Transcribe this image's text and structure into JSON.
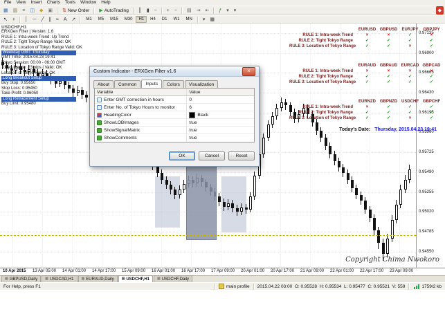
{
  "menu": {
    "items": [
      "File",
      "View",
      "Insert",
      "Charts",
      "Tools",
      "Window",
      "Help"
    ]
  },
  "toolbar1": {
    "items": [
      {
        "name": "new-chart-icon",
        "glyph": "▦",
        "color": "#3c6eb4"
      },
      {
        "name": "profiles-icon",
        "glyph": "▥",
        "color": "#8a7a52"
      },
      {
        "name": "market-watch-icon",
        "glyph": "≡",
        "color": "#2e8b57"
      },
      {
        "name": "data-window-icon",
        "glyph": "◫",
        "color": "#3c6eb4"
      },
      {
        "name": "navigator-icon",
        "glyph": "◆",
        "color": "#c8a028"
      },
      {
        "name": "terminal-icon",
        "glyph": "▣",
        "color": "#777777"
      },
      {
        "sep": true
      },
      {
        "name": "new-order-button",
        "label": "New Order",
        "glyph": "⇅",
        "color": "#c03020"
      },
      {
        "sep": true
      },
      {
        "name": "autotrading-button",
        "label": "AutoTrading",
        "glyph": "▶",
        "color": "#2e9e3a"
      },
      {
        "sep": true
      },
      {
        "name": "bar-chart-icon",
        "glyph": "║",
        "color": "#444444"
      },
      {
        "name": "candlestick-chart-icon",
        "glyph": "▮",
        "color": "#444444"
      },
      {
        "name": "line-chart-icon",
        "glyph": "~",
        "color": "#444444"
      },
      {
        "sep": true
      },
      {
        "name": "zoom-in-icon",
        "glyph": "+",
        "color": "#444444"
      },
      {
        "name": "zoom-out-icon",
        "glyph": "−",
        "color": "#444444"
      },
      {
        "sep": true
      },
      {
        "name": "tile-windows-icon",
        "glyph": "▤",
        "color": "#666666"
      },
      {
        "name": "auto-scroll-icon",
        "glyph": "⇥",
        "color": "#666666"
      },
      {
        "name": "chart-shift-icon",
        "glyph": "⇤",
        "color": "#666666"
      },
      {
        "sep": true
      },
      {
        "name": "indicators-icon",
        "glyph": "ƒ",
        "color": "#2e7d32"
      },
      {
        "name": "indicator-list-dropdown",
        "glyph": "▾",
        "color": "#444444"
      },
      {
        "name": "templates-dropdown",
        "glyph": "▾",
        "color": "#444444"
      },
      {
        "name": "community-icon",
        "glyph": "◆",
        "color": "#ffffff",
        "bg": "#d03a2a",
        "right": true
      }
    ]
  },
  "toolbar2": {
    "active": "H1",
    "items": [
      {
        "name": "cursor-icon",
        "glyph": "↖",
        "color": "#333333"
      },
      {
        "name": "crosshair-icon",
        "glyph": "+",
        "color": "#333333"
      },
      {
        "sep": true
      },
      {
        "name": "vertical-line-icon",
        "glyph": "│",
        "color": "#333333"
      },
      {
        "name": "horizontal-line-icon",
        "glyph": "─",
        "color": "#333333"
      },
      {
        "name": "trendline-icon",
        "glyph": "╱",
        "color": "#333333"
      },
      {
        "name": "channel-icon",
        "glyph": "∥",
        "color": "#333333"
      },
      {
        "name": "fibonacci-icon",
        "glyph": "≈",
        "color": "#333333"
      },
      {
        "name": "text-icon",
        "glyph": "A",
        "color": "#333333"
      },
      {
        "name": "arrow-icon",
        "glyph": "↗",
        "color": "#333333"
      },
      {
        "sep": true
      },
      {
        "tf": "M1"
      },
      {
        "tf": "M5"
      },
      {
        "tf": "M15"
      },
      {
        "tf": "M30"
      },
      {
        "tf": "H1"
      },
      {
        "tf": "H4"
      },
      {
        "tf": "D1"
      },
      {
        "tf": "W1"
      },
      {
        "tf": "MN"
      },
      {
        "sep": true
      },
      {
        "name": "period-dropdown",
        "glyph": "▾",
        "color": "#444444"
      },
      {
        "name": "template-icon",
        "glyph": "▦",
        "color": "#444444"
      }
    ]
  },
  "chart": {
    "comments": [
      {
        "text": "USDCHF,H1",
        "style": "symbol"
      },
      {
        "text": "ERXGen Filter | Version: 1.6"
      },
      {
        "text": "RULE 1: Intra-week Trend: Up Trend"
      },
      {
        "text": "RULE 2: Tight Tokyo Range Valid: OK"
      },
      {
        "text": "RULE 3: Location of Tokyo Range Valid: OK"
      },
      {
        "text": "Weekday GMT: Thursday",
        "highlight": true
      },
      {
        "text": "GMT Time: 2015.04.23 19:41"
      },
      {
        "text": "Tokyo Session: 00:00 - 06:00 GMT"
      },
      {
        "text": "Tokyo Range: 23 pips | Valid: OK"
      },
      {
        "text": "Location of Tokyo Range: OK"
      },
      {
        "text": "Long Breakout Setup",
        "highlight": true
      },
      {
        "text": "Buy Stop: 0.95650"
      },
      {
        "text": "Stop Loss: 0.95450"
      },
      {
        "text": "Take Profit: 0.96050"
      },
      {
        "text": "Long Retracement Setup",
        "highlight": true
      },
      {
        "text": "Buy Limit: 0.95480"
      }
    ]
  },
  "chart_data": {
    "type": "candlestick",
    "symbol": "USDCHF",
    "period": "H1",
    "ylim": [
      0.9435,
      0.9725
    ],
    "price_axis_labels": [
      0.97135,
      0.969,
      0.96665,
      0.9643,
      0.96195,
      0.9596,
      0.95725,
      0.9549,
      0.95255,
      0.9502,
      0.94785,
      0.9455
    ],
    "time_labels": [
      "10 Apr 2015",
      "13 Apr 05:00",
      "14 Apr 01:00",
      "14 Apr 17:00",
      "15 Apr 09:00",
      "16 Apr 01:00",
      "16 Apr 17:00",
      "17 Apr 09:00",
      "20 Apr 01:00",
      "20 Apr 17:00",
      "21 Apr 09:00",
      "22 Apr 01:00",
      "22 Apr 17:00",
      "23 Apr 09:00"
    ],
    "hline": {
      "price": 0.9474
    },
    "boxes": [
      {
        "from": 35,
        "to": 40,
        "top": 0.9544,
        "bottom": 0.9483,
        "shade": "light"
      },
      {
        "from": 42,
        "to": 48,
        "top": 0.9563,
        "bottom": 0.947,
        "shade": "dark"
      },
      {
        "from": 50,
        "to": 55,
        "top": 0.9544,
        "bottom": 0.9478,
        "shade": "light"
      }
    ],
    "candles": [
      [
        0.968,
        0.9685,
        0.9671,
        0.9676
      ],
      [
        0.9676,
        0.968,
        0.9667,
        0.9672
      ],
      [
        0.9672,
        0.9676,
        0.9664,
        0.9669
      ],
      [
        0.9669,
        0.9679,
        0.9665,
        0.9674
      ],
      [
        0.9674,
        0.9678,
        0.9665,
        0.967
      ],
      [
        0.967,
        0.9674,
        0.9663,
        0.9668
      ],
      [
        0.9668,
        0.9676,
        0.9664,
        0.9671
      ],
      [
        0.9671,
        0.9675,
        0.9662,
        0.9667
      ],
      [
        0.9667,
        0.9671,
        0.9658,
        0.9663
      ],
      [
        0.9663,
        0.9671,
        0.9659,
        0.9666
      ],
      [
        0.9666,
        0.967,
        0.9657,
        0.9662
      ],
      [
        0.9662,
        0.9666,
        0.9653,
        0.9658
      ],
      [
        0.9658,
        0.9662,
        0.9649,
        0.9654
      ],
      [
        0.9654,
        0.9662,
        0.965,
        0.9657
      ],
      [
        0.9657,
        0.9661,
        0.9647,
        0.9652
      ],
      [
        0.9652,
        0.9656,
        0.9643,
        0.9648
      ],
      [
        0.9648,
        0.9652,
        0.9638,
        0.9643
      ],
      [
        0.9643,
        0.9651,
        0.9639,
        0.9646
      ],
      [
        0.9646,
        0.965,
        0.9636,
        0.9641
      ],
      [
        0.9641,
        0.9645,
        0.9632,
        0.9637
      ],
      [
        0.9637,
        0.9641,
        0.9627,
        0.9632
      ],
      [
        0.9632,
        0.9636,
        0.9623,
        0.9628
      ],
      [
        0.9628,
        0.9632,
        0.9619,
        0.9624
      ],
      [
        0.9624,
        0.9628,
        0.9615,
        0.962
      ],
      [
        0.962,
        0.9624,
        0.9611,
        0.9616
      ],
      [
        0.9616,
        0.962,
        0.9606,
        0.9611
      ],
      [
        0.9611,
        0.9615,
        0.9602,
        0.9607
      ],
      [
        0.9607,
        0.9611,
        0.9598,
        0.9603
      ],
      [
        0.9603,
        0.9607,
        0.9593,
        0.9598
      ],
      [
        0.9598,
        0.9602,
        0.9589,
        0.9594
      ],
      [
        0.9594,
        0.9598,
        0.9583,
        0.9588
      ],
      [
        0.9588,
        0.9592,
        0.9575,
        0.958
      ],
      [
        0.958,
        0.9584,
        0.9568,
        0.9573
      ],
      [
        0.9573,
        0.9577,
        0.956,
        0.9565
      ],
      [
        0.9565,
        0.9569,
        0.9551,
        0.9556
      ],
      [
        0.9556,
        0.956,
        0.9543,
        0.9548
      ],
      [
        0.9548,
        0.9552,
        0.9535,
        0.954
      ],
      [
        0.954,
        0.9544,
        0.9529,
        0.9534
      ],
      [
        0.9534,
        0.9538,
        0.9523,
        0.9528
      ],
      [
        0.9528,
        0.9532,
        0.9517,
        0.9522
      ],
      [
        0.9522,
        0.9533,
        0.9518,
        0.9528
      ],
      [
        0.9528,
        0.954,
        0.9524,
        0.9535
      ],
      [
        0.9535,
        0.9545,
        0.9531,
        0.954
      ],
      [
        0.954,
        0.9544,
        0.9531,
        0.9536
      ],
      [
        0.9536,
        0.9547,
        0.9532,
        0.9542
      ],
      [
        0.9542,
        0.9546,
        0.9532,
        0.9537
      ],
      [
        0.9537,
        0.9541,
        0.9526,
        0.9531
      ],
      [
        0.9531,
        0.9535,
        0.9521,
        0.9526
      ],
      [
        0.9526,
        0.953,
        0.9515,
        0.952
      ],
      [
        0.952,
        0.9524,
        0.9509,
        0.9514
      ],
      [
        0.9514,
        0.9518,
        0.9503,
        0.9508
      ],
      [
        0.9508,
        0.9517,
        0.9504,
        0.9512
      ],
      [
        0.9512,
        0.9516,
        0.9501,
        0.9506
      ],
      [
        0.9506,
        0.951,
        0.9497,
        0.9502
      ],
      [
        0.9502,
        0.9512,
        0.9498,
        0.9507
      ],
      [
        0.9507,
        0.9511,
        0.95,
        0.9505
      ],
      [
        0.9505,
        0.9525,
        0.9501,
        0.952
      ],
      [
        0.952,
        0.955,
        0.9516,
        0.9545
      ],
      [
        0.9545,
        0.9575,
        0.9541,
        0.957
      ],
      [
        0.957,
        0.9595,
        0.9566,
        0.959
      ],
      [
        0.959,
        0.961,
        0.9586,
        0.9605
      ],
      [
        0.9605,
        0.962,
        0.9601,
        0.9615
      ],
      [
        0.9615,
        0.963,
        0.9611,
        0.9625
      ],
      [
        0.9625,
        0.9637,
        0.9621,
        0.9632
      ],
      [
        0.9632,
        0.9636,
        0.9623,
        0.9628
      ],
      [
        0.9628,
        0.9632,
        0.9615,
        0.962
      ],
      [
        0.962,
        0.9624,
        0.9607,
        0.9612
      ],
      [
        0.9612,
        0.9623,
        0.9608,
        0.9618
      ],
      [
        0.9618,
        0.963,
        0.9614,
        0.9625
      ],
      [
        0.9625,
        0.9629,
        0.9613,
        0.9618
      ],
      [
        0.9618,
        0.9622,
        0.9603,
        0.9608
      ],
      [
        0.9608,
        0.9612,
        0.9593,
        0.9598
      ],
      [
        0.9598,
        0.9602,
        0.9585,
        0.959
      ],
      [
        0.959,
        0.9594,
        0.9575,
        0.958
      ],
      [
        0.958,
        0.9584,
        0.9565,
        0.957
      ],
      [
        0.957,
        0.9574,
        0.9557,
        0.9562
      ],
      [
        0.9562,
        0.9566,
        0.955,
        0.9555
      ],
      [
        0.9555,
        0.9559,
        0.9543,
        0.9548
      ],
      [
        0.9548,
        0.9552,
        0.9535,
        0.954
      ],
      [
        0.954,
        0.9544,
        0.9525,
        0.953
      ],
      [
        0.953,
        0.9534,
        0.9517,
        0.9522
      ],
      [
        0.9522,
        0.9526,
        0.951,
        0.9515
      ],
      [
        0.9515,
        0.9519,
        0.95,
        0.9505
      ],
      [
        0.9505,
        0.9509,
        0.949,
        0.9495
      ],
      [
        0.9495,
        0.9499,
        0.9474,
        0.948
      ],
      [
        0.948,
        0.9484,
        0.9458,
        0.9465
      ],
      [
        0.9465,
        0.947,
        0.9444,
        0.9452
      ],
      [
        0.9452,
        0.9476,
        0.9448,
        0.947
      ],
      [
        0.947,
        0.9498,
        0.9466,
        0.9492
      ],
      [
        0.9492,
        0.9516,
        0.9488,
        0.951
      ],
      [
        0.951,
        0.9534,
        0.9506,
        0.9528
      ],
      [
        0.9528,
        0.9546,
        0.9524,
        0.954
      ],
      [
        0.954,
        0.9558,
        0.9536,
        0.9552
      ]
    ]
  },
  "matrix": {
    "check_glyph": "✓",
    "x_glyph": "×",
    "groups": [
      {
        "currencies": [
          "EURUSD",
          "GBPUSD",
          "EURJPY",
          "GBPJPY"
        ],
        "rows": [
          {
            "label": "RULE 1: Intra-week Trend",
            "marks": [
              "x",
              "x",
              "c",
              "x"
            ]
          },
          {
            "label": "RULE 2: Tight Tokyo Range",
            "marks": [
              "c",
              "c",
              "c",
              "c"
            ]
          },
          {
            "label": "RULE 3: Location of Tokyo Range",
            "marks": [
              "c",
              "c",
              "x",
              "c"
            ]
          }
        ]
      },
      {
        "currencies": [
          "EURAUD",
          "GBPAUD",
          "EURCAD",
          "GBPCAD"
        ],
        "rows": [
          {
            "label": "RULE 1: Intra-week Trend",
            "marks": [
              "x",
              "x",
              "x",
              "x"
            ]
          },
          {
            "label": "RULE 2: Tight Tokyo Range",
            "marks": [
              "c",
              "c",
              "c",
              "c"
            ]
          },
          {
            "label": "RULE 3: Location of Tokyo Range",
            "marks": [
              "c",
              "c",
              "c",
              "c"
            ]
          }
        ]
      },
      {
        "currencies": [
          "EURNZD",
          "GBPNZD",
          "USDCHF",
          "GBPCHF"
        ],
        "rows": [
          {
            "label": "RULE 1: Intra-week Trend",
            "marks": [
              "x",
              "c",
              "c",
              "c"
            ]
          },
          {
            "label": "RULE 2: Tight Tokyo Range",
            "marks": [
              "c",
              "c",
              "c",
              "c"
            ]
          },
          {
            "label": "RULE 3: Location of Tokyo Range",
            "marks": [
              "c",
              "c",
              "x",
              "c"
            ]
          }
        ]
      }
    ],
    "date_label": "Today's Date:",
    "date_value": "Thursday, 2015.04.23 19:41"
  },
  "copyright": "Copyright Chima Nwokoro",
  "dialog": {
    "title": "Custom Indicator - ERXGen Filter v1.6",
    "close_glyph": "×",
    "tabs": [
      "About",
      "Common",
      "Inputs",
      "Colors",
      "Visualization"
    ],
    "active_tab": "Inputs",
    "headers": [
      "Variable",
      "Value"
    ],
    "rows": [
      {
        "icon": "number",
        "variable": "Enter GMT correction in hours",
        "value": "0"
      },
      {
        "icon": "number",
        "variable": "Enter No. of Tokyo Hours to monitor",
        "value": "6"
      },
      {
        "icon": "color",
        "variable": "HeadingColor",
        "value": "Black",
        "swatch": "#000000"
      },
      {
        "icon": "bool",
        "variable": "ShowLOBImages",
        "value": "true"
      },
      {
        "icon": "bool",
        "variable": "ShowSignalMatrix",
        "value": "true"
      },
      {
        "icon": "bool",
        "variable": "ShowComments",
        "value": "true"
      }
    ],
    "buttons": [
      "OK",
      "Cancel",
      "Reset"
    ],
    "default_button": "OK"
  },
  "footer": {
    "tab_icon_glyph": "▦",
    "chart_tabs": [
      "GBPUSD,Daily",
      "USDCAD,H1",
      "EURAUD,Daily",
      "USDCHF,H1",
      "USDCHF,Daily"
    ],
    "active_chart_tab": "USDCHF,H1",
    "status_help": "For Help, press F1",
    "status_profile": "main profile",
    "status_quote": "2015.04.22 03:00  O: 0.95528  H: 0.95534  L: 0.95477  C: 0.95521  V: 559",
    "status_traffic": "1759/2 kb"
  }
}
